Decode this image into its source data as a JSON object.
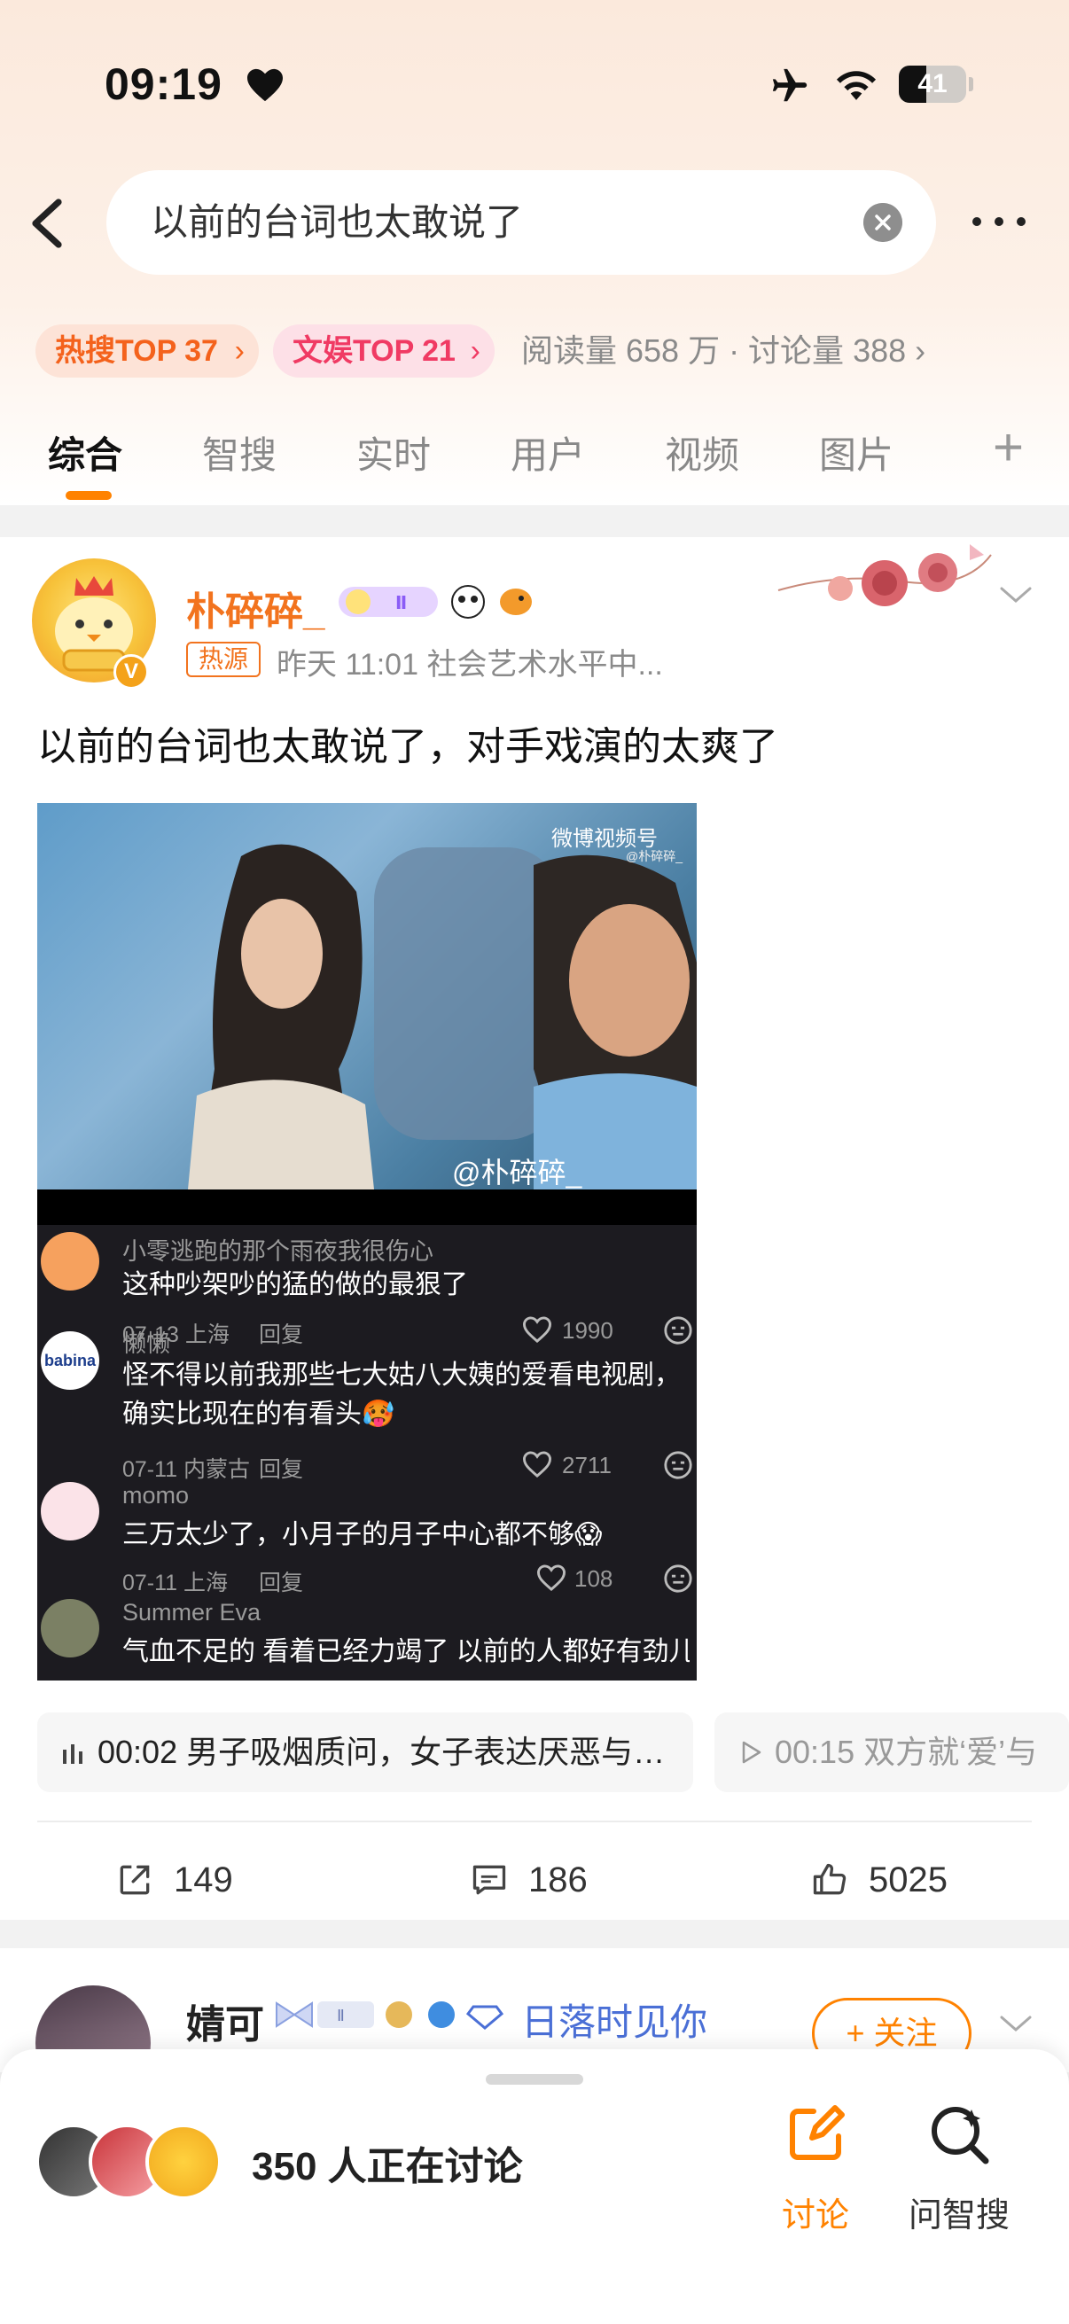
{
  "status_bar": {
    "time": "09:19",
    "battery": "41",
    "battery_level": 0.41
  },
  "search": {
    "query": "以前的台词也太敢说了"
  },
  "topic_tags": [
    {
      "label": "热搜TOP 37",
      "chevron": "›"
    },
    {
      "label": "文娱TOP 21",
      "chevron": "›"
    }
  ],
  "read_stats": "阅读量 658 万 · 讨论量 388 ›",
  "tabs": [
    {
      "label": "综合",
      "active": true
    },
    {
      "label": "智搜"
    },
    {
      "label": "实时"
    },
    {
      "label": "用户"
    },
    {
      "label": "视频"
    },
    {
      "label": "图片"
    }
  ],
  "tab_more": "+",
  "post": {
    "username": "朴碎碎_",
    "avatar_badge": "V",
    "source_badge": "热源",
    "meta": "昨天 11:01  社会艺术水平中...",
    "text": "以前的台词也太敢说了，对手戏演的太爽了",
    "media": {
      "watermark": "微博视频号",
      "watermark_sub": "@朴碎碎_",
      "at_label": "@朴碎碎_",
      "comments": [
        {
          "name": "小零逃跑的那个雨夜我很伤心",
          "text": "这种吵架吵的猛的做的最狠了",
          "date": "07-13 上海",
          "reply": "回复",
          "likes": "1990"
        },
        {
          "name": "懒懒",
          "text": "怪不得以前我那些七大姑八大姨的爱看电视剧，确实比现在的有看头🥵",
          "date": "07-11 内蒙古",
          "reply": "回复",
          "likes": "2711",
          "avatar_text": "babina"
        },
        {
          "name": "momo",
          "text": "三万太少了，小月子的月子中心都不够😱",
          "date": "07-11 上海",
          "reply": "回复",
          "likes": "108"
        },
        {
          "name": "Summer Eva",
          "text": "气血不足的 看着已经力竭了 以前的人都好有劲儿 哈",
          "date": "",
          "reply": "",
          "likes": ""
        }
      ]
    },
    "chips": [
      {
        "text": "00:02 男子吸烟质问，女子表达厌恶与…",
        "icon": "audio-bars-icon"
      },
      {
        "text": "00:15 双方就‘爱’与",
        "icon": "play-icon"
      }
    ],
    "actions": {
      "repost": "149",
      "comment": "186",
      "like": "5025"
    }
  },
  "post2": {
    "username": "婧可",
    "username_b": "日落时见你",
    "follow_label": "+ 关注"
  },
  "bottom_bar": {
    "discuss_count": "350 人正在讨论",
    "discuss_label": "讨论",
    "ai_search_label": "问智搜"
  },
  "colors": {
    "accent": "#ff8200",
    "hot_tag": "#f4621c",
    "ent_tag": "#f03a63",
    "link_blue": "#4a6fd6"
  }
}
